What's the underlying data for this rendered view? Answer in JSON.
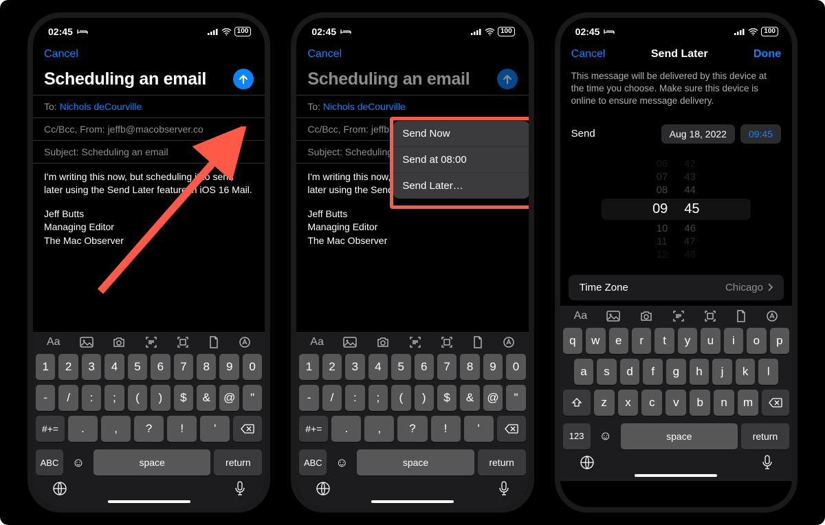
{
  "status": {
    "time": "02:45",
    "battery": "100"
  },
  "compose": {
    "cancel": "Cancel",
    "subject_title": "Scheduling an email",
    "to_label": "To:",
    "to_value": "Nichols deCourville",
    "cc_label": "Cc/Bcc, From:",
    "cc_value": "jeffb@macobserver.co",
    "subject_label": "Subject:",
    "subject_value": "Scheduling an email",
    "body": "I'm writing this now, but scheduling it to send later using the Send Later feature in iOS 16 Mail.",
    "sig1": "Jeff Butts",
    "sig2": "Managing Editor",
    "sig3": "The Mac Observer"
  },
  "popover": {
    "send_now": "Send Now",
    "send_at": "Send at 08:00",
    "send_later": "Send Later…"
  },
  "send_later": {
    "cancel": "Cancel",
    "title": "Send Later",
    "done": "Done",
    "desc": "This message will be delivered by this device at the time you choose. Make sure this device is online to ensure message delivery.",
    "send_label": "Send",
    "date": "Aug 18, 2022",
    "time": "09:45",
    "wheel": {
      "r0_h": "06",
      "r0_m": "42",
      "r1_h": "07",
      "r1_m": "43",
      "r2_h": "08",
      "r2_m": "44",
      "sel_h": "09",
      "sel_m": "45",
      "r4_h": "10",
      "r4_m": "46",
      "r5_h": "11",
      "r5_m": "47",
      "r6_h": "12",
      "r6_m": "48"
    },
    "tz_label": "Time Zone",
    "tz_value": "Chicago"
  },
  "keyboard": {
    "num_row": [
      "1",
      "2",
      "3",
      "4",
      "5",
      "6",
      "7",
      "8",
      "9",
      "0"
    ],
    "sym_row": [
      "-",
      "/",
      ":",
      ";",
      "(",
      ")",
      "$",
      "&",
      "@",
      "\""
    ],
    "punct_row": [
      ".",
      ",",
      "?",
      "!",
      "'"
    ],
    "qwerty1": [
      "q",
      "w",
      "e",
      "r",
      "t",
      "y",
      "u",
      "i",
      "o",
      "p"
    ],
    "qwerty2": [
      "a",
      "s",
      "d",
      "f",
      "g",
      "h",
      "j",
      "k",
      "l"
    ],
    "qwerty3": [
      "z",
      "x",
      "c",
      "v",
      "b",
      "n",
      "m"
    ],
    "space": "space",
    "return": "return",
    "abc": "ABC",
    "num": "123",
    "hash": "#+="
  }
}
